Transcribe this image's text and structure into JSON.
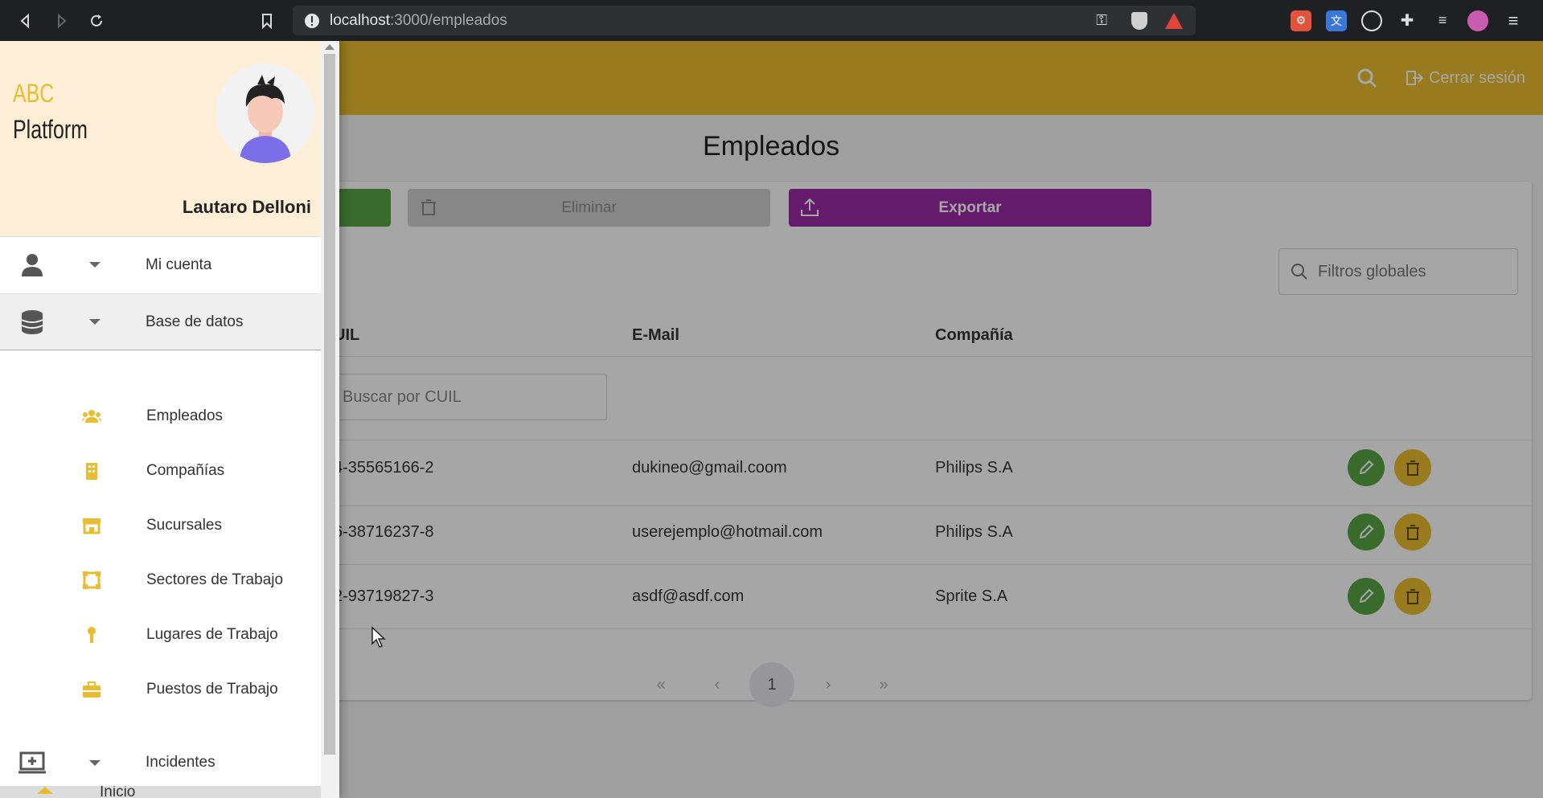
{
  "browser": {
    "url_host": "localhost",
    "url_path": ":3000/empleados"
  },
  "topbar": {
    "logout_label": "Cerrar sesión"
  },
  "page": {
    "title": "Empleados"
  },
  "toolbar": {
    "delete_label": "Eliminar",
    "export_label": "Exportar"
  },
  "filters": {
    "global_placeholder": "Filtros globales",
    "cuil_placeholder": "Buscar por CUIL"
  },
  "table": {
    "columns": [
      "UIL",
      "E-Mail",
      "Compañía"
    ],
    "rows": [
      {
        "cuil": "4-35565166-2",
        "email": "dukineo@gmail.coom",
        "company": "Philips S.A"
      },
      {
        "cuil": "6-38716237-8",
        "email": "userejemplo@hotmail.com",
        "company": "Philips S.A"
      },
      {
        "cuil": "2-93719827-3",
        "email": "asdf@asdf.com",
        "company": "Sprite S.A"
      }
    ]
  },
  "pagination": {
    "first": "«",
    "prev": "‹",
    "current": "1",
    "next": "›",
    "last": "»"
  },
  "drawer": {
    "brand_line1": "ABC",
    "brand_line2": "Platform",
    "user_name": "Lautaro Delloni",
    "menu": [
      {
        "label": "Mi cuenta",
        "icon": "user-icon"
      },
      {
        "label": "Base de datos",
        "icon": "database-icon"
      },
      {
        "label": "Incidentes",
        "icon": "laptop-plus-icon"
      },
      {
        "label": "Inicio",
        "icon": "home-icon"
      }
    ],
    "submenu": [
      {
        "label": "Empleados",
        "icon": "users-icon"
      },
      {
        "label": "Compañías",
        "icon": "building-icon"
      },
      {
        "label": "Sucursales",
        "icon": "store-icon"
      },
      {
        "label": "Sectores de Trabajo",
        "icon": "sector-icon"
      },
      {
        "label": "Lugares de Trabajo",
        "icon": "pin-icon"
      },
      {
        "label": "Puestos de Trabajo",
        "icon": "briefcase-icon"
      }
    ]
  },
  "colors": {
    "accent": "#e9bd2e",
    "success": "#58a546",
    "export": "#9c2aa6",
    "drawer_header": "#fdefd7"
  }
}
